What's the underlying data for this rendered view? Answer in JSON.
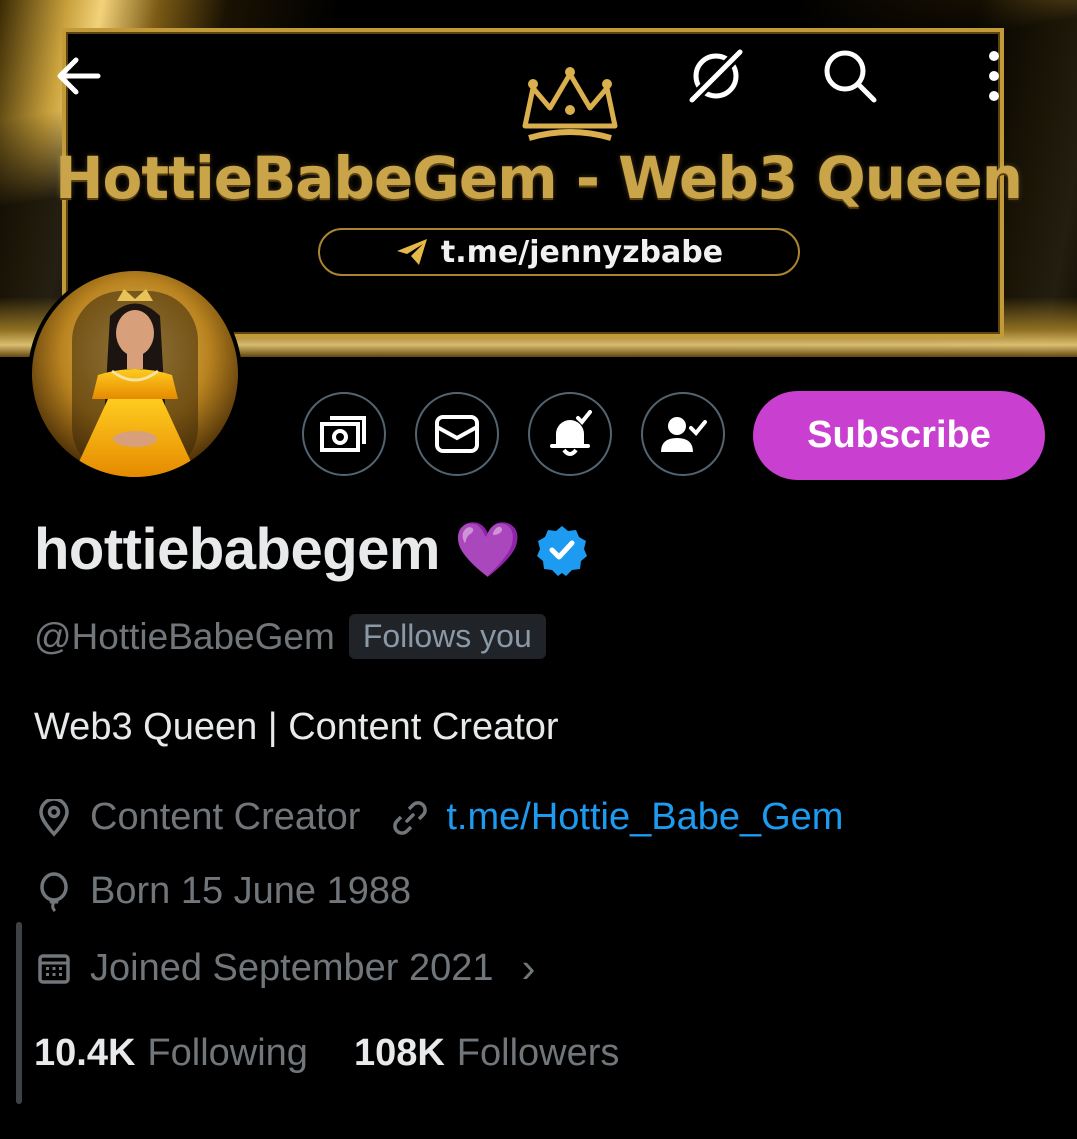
{
  "banner": {
    "title": "HottieBabeGem - Web3 Queen",
    "link": "t.me/jennyzbabe"
  },
  "toolbar": {
    "icons": [
      "back-arrow-icon",
      "grok-icon",
      "search-icon",
      "more-vertical-icon"
    ]
  },
  "actions": {
    "icons": [
      "tip-money-icon",
      "message-icon",
      "notifications-on-icon",
      "following-icon"
    ],
    "subscribe_label": "Subscribe",
    "subscribe_color": "#c93fd0"
  },
  "profile": {
    "display_name": "hottiebabegem",
    "emoji": "💜",
    "verified_color": "#1d9bf0",
    "handle": "@HottieBabeGem",
    "follows_you": "Follows you",
    "bio": "Web3 Queen | Content Creator",
    "location": "Content Creator",
    "website": "t.me/Hottie_Babe_Gem",
    "born": "Born 15 June 1988",
    "joined": "Joined September 2021",
    "joined_chevron": "›"
  },
  "stats": {
    "following_count": "10.4K",
    "following_label": "Following",
    "followers_count": "108K",
    "followers_label": "Followers"
  }
}
